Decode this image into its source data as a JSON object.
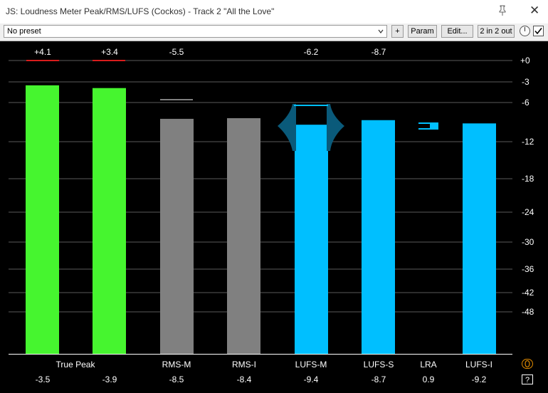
{
  "window": {
    "title": "JS: Loudness Meter Peak/RMS/LUFS (Cockos) - Track 2 \"All the Love\"",
    "pin_icon": "pin-icon",
    "close_label": "✕"
  },
  "toolbar": {
    "preset_value": "No preset",
    "plus_label": "+",
    "param_label": "Param",
    "edit_label": "Edit...",
    "io_label": "2 in 2 out"
  },
  "meter": {
    "scale_labels": [
      "+0",
      "-3",
      "-6",
      "-12",
      "-18",
      "-24",
      "-30",
      "-36",
      "-42",
      "-48"
    ],
    "scale_values": [
      0,
      -3,
      -6,
      -12,
      -18,
      -24,
      -30,
      -36,
      -42,
      -48
    ],
    "peak_values": [
      "+4.1",
      "+3.4",
      "-5.5",
      "",
      "-6.2",
      "-8.7",
      "",
      ""
    ],
    "labels": [
      "True Peak",
      "RMS-M",
      "RMS-I",
      "LUFS-M",
      "LUFS-S",
      "LRA",
      "LUFS-I"
    ],
    "bottom_values": [
      "-3.5",
      "-3.9",
      "-8.5",
      "-8.4",
      "-9.4",
      "-8.7",
      "0.9",
      "-9.2"
    ],
    "bars": [
      {
        "name": "true-peak-left",
        "value": -3.5,
        "color": "#46f52f"
      },
      {
        "name": "true-peak-right",
        "value": -3.9,
        "color": "#46f52f"
      },
      {
        "name": "rms-m",
        "value": -8.5,
        "color": "#808080"
      },
      {
        "name": "rms-i",
        "value": -8.4,
        "color": "#808080"
      },
      {
        "name": "lufs-m",
        "value": -9.4,
        "color": "#00bfff"
      },
      {
        "name": "lufs-s",
        "value": -8.7,
        "color": "#00bfff"
      },
      {
        "name": "lufs-i",
        "value": -9.2,
        "color": "#00bfff"
      }
    ],
    "colors": {
      "true_peak": "#46f52f",
      "rms": "#808080",
      "lufs": "#00bfff",
      "overload": "#d81c1c",
      "lufs_shape": "#0a5a7a"
    },
    "right_buttons": [
      {
        "icon": "loop-icon",
        "label": "()"
      },
      {
        "icon": "help-icon",
        "label": "?"
      }
    ]
  }
}
